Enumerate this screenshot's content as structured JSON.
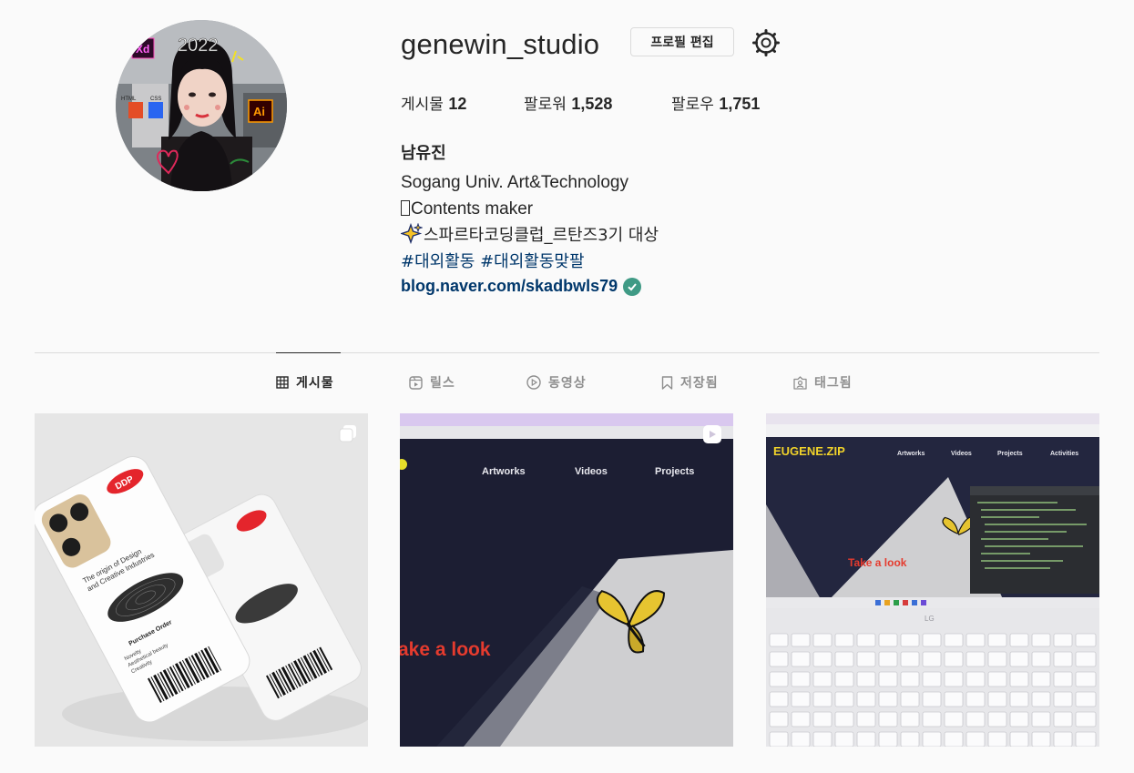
{
  "profile": {
    "username": "genewin_studio",
    "edit_button": "프로필 편집",
    "display_name": "남유진",
    "avatar_text": {
      "year": "2022",
      "xd_label": "Xd",
      "ai_label": "Ai",
      "html_label": "HTML",
      "css_label": "CSS"
    }
  },
  "stats": {
    "posts_label": "게시물",
    "posts_count": "12",
    "followers_label": "팔로워",
    "followers_count": "1,528",
    "following_label": "팔로우",
    "following_count": "1,751"
  },
  "bio": {
    "line1": "Sogang Univ. Art&Technology",
    "line2": "Contents maker",
    "line3": "스파르타코딩클럽_르탄즈3기 대상",
    "hashtag1": "#대외활동",
    "hashtag2": "#대외활동맞팔",
    "link": "blog.naver.com/skadbwls79"
  },
  "tabs": [
    {
      "label": "게시물",
      "icon": "grid-icon",
      "active": true
    },
    {
      "label": "릴스",
      "icon": "reels-icon",
      "active": false
    },
    {
      "label": "동영상",
      "icon": "video-icon",
      "active": false
    },
    {
      "label": "저장됨",
      "icon": "bookmark-icon",
      "active": false
    },
    {
      "label": "태그됨",
      "icon": "tagged-icon",
      "active": false
    }
  ],
  "posts": [
    {
      "badge": "carousel-icon",
      "brand": "DDP",
      "caption_l1": "The origin of Design",
      "caption_l2": "and Creative Industries",
      "order_label": "Purchase Order",
      "item1": "Novelty",
      "item2": "Aesthetical beauty",
      "item3": "Creativity"
    },
    {
      "badge": "reel-icon",
      "nav1": "Artworks",
      "nav2": "Videos",
      "nav3": "Projects",
      "headline": "ake a look"
    },
    {
      "badge": "",
      "brand": "EUGENE.ZIP",
      "nav1": "Artworks",
      "nav2": "Videos",
      "nav3": "Projects",
      "nav4": "Activities",
      "headline": "Take a look",
      "laptop_logo": "LG"
    }
  ],
  "colors": {
    "background": "#fafafa",
    "text": "#262626",
    "muted": "#8e8e8e",
    "link": "#00376b",
    "border": "#dbdbdb",
    "verified": "#3f9a85"
  }
}
